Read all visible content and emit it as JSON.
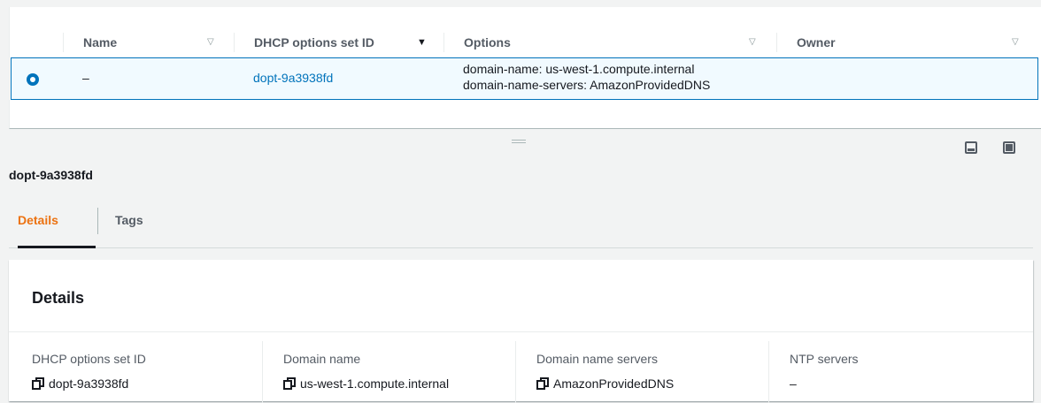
{
  "table": {
    "columns": [
      {
        "label": "Name",
        "sort": "unsorted"
      },
      {
        "label": "DHCP options set ID",
        "sort": "sorted"
      },
      {
        "label": "Options",
        "sort": "unsorted"
      },
      {
        "label": "Owner",
        "sort": "unsorted"
      }
    ],
    "rows": [
      {
        "selected": true,
        "name": "–",
        "dhcp_options_set_id": "dopt-9a3938fd",
        "options": [
          "domain-name: us-west-1.compute.internal",
          "domain-name-servers: AmazonProvidedDNS"
        ],
        "owner": ""
      }
    ]
  },
  "detail": {
    "title": "dopt-9a3938fd",
    "tabs": [
      {
        "label": "Details",
        "active": true
      },
      {
        "label": "Tags",
        "active": false
      }
    ],
    "section_title": "Details",
    "fields": [
      {
        "label": "DHCP options set ID",
        "value": "dopt-9a3938fd",
        "copy": true
      },
      {
        "label": "Domain name",
        "value": "us-west-1.compute.internal",
        "copy": true
      },
      {
        "label": "Domain name servers",
        "value": "AmazonProvidedDNS",
        "copy": true
      },
      {
        "label": "NTP servers",
        "value": "–",
        "copy": false
      }
    ]
  },
  "icons": {
    "sort": "caret-down-icon",
    "copy": "copy-icon",
    "radio": "radio-selected-icon",
    "panel_bottom": "split-panel-bottom-icon",
    "panel_full": "split-panel-full-icon",
    "resize": "drag-handle-icon"
  },
  "colors": {
    "link": "#0073bb",
    "active_tab": "#ec7211",
    "selected_row_bg": "#f1faff",
    "selected_row_border": "#0073bb"
  }
}
